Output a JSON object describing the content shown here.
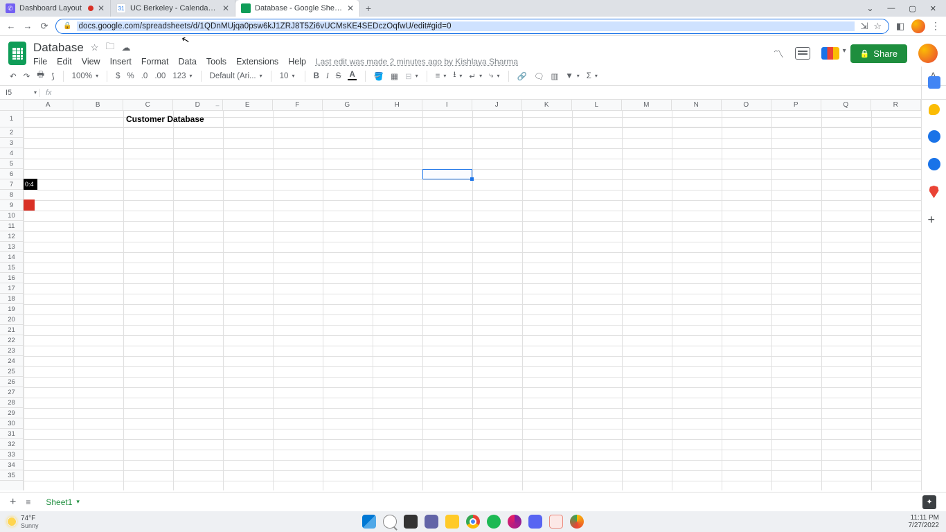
{
  "browser": {
    "tabs": [
      {
        "title": "Dashboard Layout",
        "recording": true
      },
      {
        "title": "UC Berkeley - Calendar - Week o"
      },
      {
        "title": "Database - Google Sheets"
      }
    ],
    "url": "docs.google.com/spreadsheets/d/1QDnMUjqa0psw6kJ1ZRJ8T5Zi6vUCMsKE4SEDczOqfwU/edit#gid=0"
  },
  "doc": {
    "title": "Database",
    "menus": [
      "File",
      "Edit",
      "View",
      "Insert",
      "Format",
      "Data",
      "Tools",
      "Extensions",
      "Help"
    ],
    "last_edit": "Last edit was made 2 minutes ago by Kishlaya Sharma",
    "share": "Share"
  },
  "toolbar": {
    "zoom": "100%",
    "font": "Default (Ari...",
    "size": "10",
    "decimal_dec": ".0",
    "decimal_inc": ".00",
    "numfmt": "123"
  },
  "grid": {
    "name_box": "I5",
    "columns": [
      "A",
      "B",
      "C",
      "D",
      "E",
      "F",
      "G",
      "H",
      "I",
      "J",
      "K",
      "L",
      "M",
      "N",
      "O",
      "P",
      "Q",
      "R"
    ],
    "row_count": 35,
    "content": {
      "C1": "Customer Database"
    },
    "selected_cell": "I5",
    "badges": {
      "row6": "0:4"
    }
  },
  "sheet_tabs": {
    "active": "Sheet1"
  },
  "system": {
    "temp": "74°F",
    "cond": "Sunny",
    "time": "11:11 PM",
    "date": "7/27/2022"
  }
}
